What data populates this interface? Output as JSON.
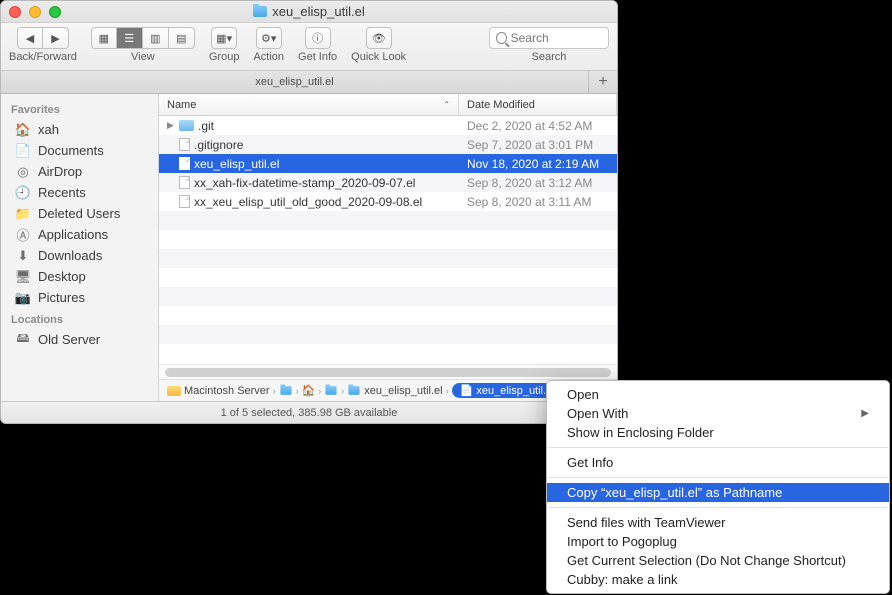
{
  "window": {
    "title": "xeu_elisp_util.el"
  },
  "toolbar": {
    "back_forward": "Back/Forward",
    "view": "View",
    "group": "Group",
    "action": "Action",
    "get_info": "Get Info",
    "quick_look": "Quick Look",
    "search": "Search",
    "search_placeholder": "Search"
  },
  "tab": {
    "label": "xeu_elisp_util.el"
  },
  "sidebar": {
    "favorites_heading": "Favorites",
    "favorites": [
      {
        "icon": "home-icon",
        "label": "xah"
      },
      {
        "icon": "doc-icon",
        "label": "Documents"
      },
      {
        "icon": "airdrop-icon",
        "label": "AirDrop"
      },
      {
        "icon": "recents-icon",
        "label": "Recents"
      },
      {
        "icon": "folder-icon",
        "label": "Deleted Users"
      },
      {
        "icon": "apps-icon",
        "label": "Applications"
      },
      {
        "icon": "downloads-icon",
        "label": "Downloads"
      },
      {
        "icon": "desktop-icon",
        "label": "Desktop"
      },
      {
        "icon": "pictures-icon",
        "label": "Pictures"
      }
    ],
    "locations_heading": "Locations",
    "locations": [
      {
        "icon": "server-icon",
        "label": "Old Server"
      }
    ]
  },
  "columns": {
    "name": "Name",
    "date": "Date Modified"
  },
  "files": [
    {
      "kind": "folder",
      "expandable": true,
      "name": ".git",
      "date": "Dec 2, 2020 at 4:52 AM",
      "selected": false
    },
    {
      "kind": "doc",
      "expandable": false,
      "name": ".gitignore",
      "date": "Sep 7, 2020 at 3:01 PM",
      "selected": false
    },
    {
      "kind": "doc",
      "expandable": false,
      "name": "xeu_elisp_util.el",
      "date": "Nov 18, 2020 at 2:19 AM",
      "selected": true
    },
    {
      "kind": "doc",
      "expandable": false,
      "name": "xx_xah-fix-datetime-stamp_2020-09-07.el",
      "date": "Sep 8, 2020 at 3:12 AM",
      "selected": false
    },
    {
      "kind": "doc",
      "expandable": false,
      "name": "xx_xeu_elisp_util_old_good_2020-09-08.el",
      "date": "Sep 8, 2020 at 3:11 AM",
      "selected": false
    }
  ],
  "pathbar": {
    "segments": [
      "Macintosh Server",
      "",
      "",
      "",
      "xeu_elisp_util.el",
      "xeu_elisp_util.el"
    ]
  },
  "status": "1 of 5 selected, 385.98 GB available",
  "context_menu": {
    "items": [
      {
        "label": "Open",
        "sep_after": false
      },
      {
        "label": "Open With",
        "submenu": true,
        "sep_after": false
      },
      {
        "label": "Show in Enclosing Folder",
        "sep_after": true
      },
      {
        "label": "Get Info",
        "sep_after": true
      },
      {
        "label": "Copy “xeu_elisp_util.el” as Pathname",
        "highlight": true,
        "sep_after": true
      },
      {
        "label": "Send files with TeamViewer",
        "sep_after": false
      },
      {
        "label": "Import to Pogoplug",
        "sep_after": false
      },
      {
        "label": "Get Current Selection (Do Not Change Shortcut)",
        "sep_after": false
      },
      {
        "label": "Cubby: make a link",
        "sep_after": false
      }
    ]
  }
}
